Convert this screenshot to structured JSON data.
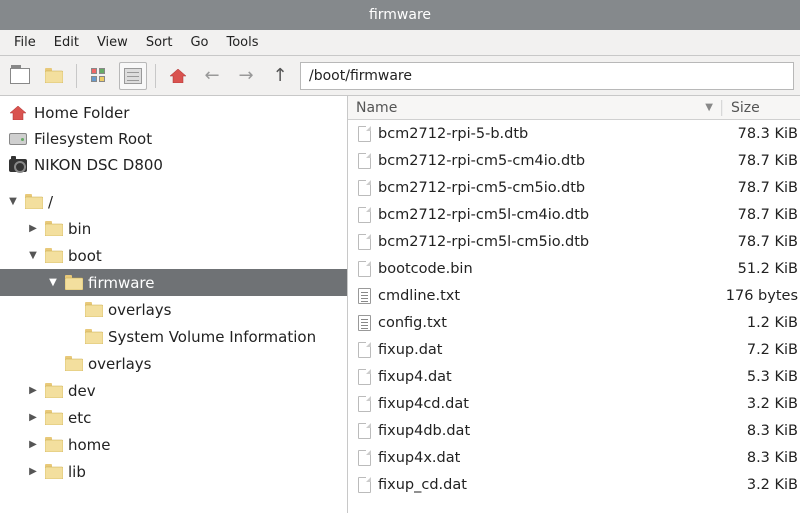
{
  "window": {
    "title": "firmware"
  },
  "menu": {
    "items": [
      "File",
      "Edit",
      "View",
      "Sort",
      "Go",
      "Tools"
    ]
  },
  "toolbar": {
    "path": "/boot/firmware"
  },
  "places": [
    {
      "id": "home",
      "label": "Home Folder",
      "icon": "home"
    },
    {
      "id": "fsroot",
      "label": "Filesystem Root",
      "icon": "disk"
    },
    {
      "id": "camera",
      "label": "NIKON DSC D800",
      "icon": "camera"
    }
  ],
  "tree": [
    {
      "depth": 0,
      "label": "/",
      "expanded": true,
      "has_children": true,
      "selected": false
    },
    {
      "depth": 1,
      "label": "bin",
      "expanded": false,
      "has_children": true,
      "selected": false
    },
    {
      "depth": 1,
      "label": "boot",
      "expanded": true,
      "has_children": true,
      "selected": false
    },
    {
      "depth": 2,
      "label": "firmware",
      "expanded": true,
      "has_children": true,
      "selected": true
    },
    {
      "depth": 3,
      "label": "overlays",
      "expanded": false,
      "has_children": false,
      "selected": false
    },
    {
      "depth": 3,
      "label": "System Volume Information",
      "expanded": false,
      "has_children": false,
      "selected": false
    },
    {
      "depth": 2,
      "label": "overlays",
      "expanded": false,
      "has_children": false,
      "selected": false
    },
    {
      "depth": 1,
      "label": "dev",
      "expanded": false,
      "has_children": true,
      "selected": false
    },
    {
      "depth": 1,
      "label": "etc",
      "expanded": false,
      "has_children": true,
      "selected": false
    },
    {
      "depth": 1,
      "label": "home",
      "expanded": false,
      "has_children": true,
      "selected": false
    },
    {
      "depth": 1,
      "label": "lib",
      "expanded": false,
      "has_children": true,
      "selected": false
    }
  ],
  "file_list": {
    "columns": {
      "name": "Name",
      "size": "Size"
    },
    "sort_column": "name",
    "sort_dir": "asc",
    "rows": [
      {
        "name": "bcm2712-rpi-5-b.dtb",
        "size": "78.3 KiB",
        "kind": "blank"
      },
      {
        "name": "bcm2712-rpi-cm5-cm4io.dtb",
        "size": "78.7 KiB",
        "kind": "blank"
      },
      {
        "name": "bcm2712-rpi-cm5-cm5io.dtb",
        "size": "78.7 KiB",
        "kind": "blank"
      },
      {
        "name": "bcm2712-rpi-cm5l-cm4io.dtb",
        "size": "78.7 KiB",
        "kind": "blank"
      },
      {
        "name": "bcm2712-rpi-cm5l-cm5io.dtb",
        "size": "78.7 KiB",
        "kind": "blank"
      },
      {
        "name": "bootcode.bin",
        "size": "51.2 KiB",
        "kind": "blank"
      },
      {
        "name": "cmdline.txt",
        "size": "176 bytes",
        "kind": "text"
      },
      {
        "name": "config.txt",
        "size": "1.2 KiB",
        "kind": "text"
      },
      {
        "name": "fixup.dat",
        "size": "7.2 KiB",
        "kind": "blank"
      },
      {
        "name": "fixup4.dat",
        "size": "5.3 KiB",
        "kind": "blank"
      },
      {
        "name": "fixup4cd.dat",
        "size": "3.2 KiB",
        "kind": "blank"
      },
      {
        "name": "fixup4db.dat",
        "size": "8.3 KiB",
        "kind": "blank"
      },
      {
        "name": "fixup4x.dat",
        "size": "8.3 KiB",
        "kind": "blank"
      },
      {
        "name": "fixup_cd.dat",
        "size": "3.2 KiB",
        "kind": "blank"
      }
    ]
  }
}
